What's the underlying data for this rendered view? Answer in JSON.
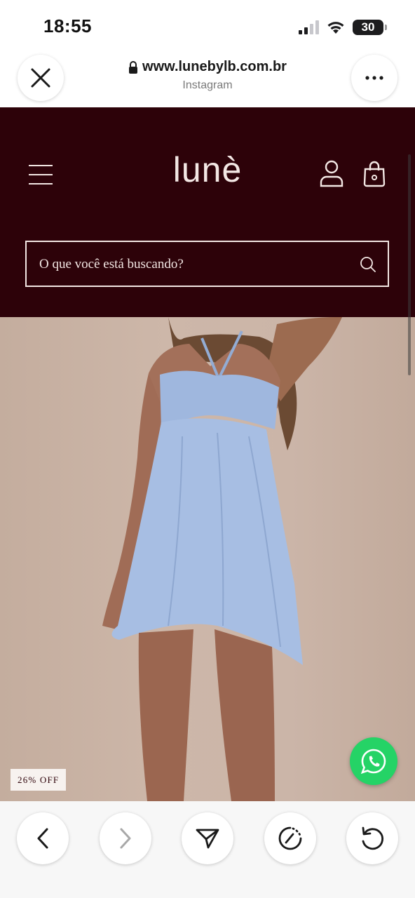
{
  "status_bar": {
    "time": "18:55",
    "battery": "30",
    "battery_level": 0.3
  },
  "browser": {
    "url": "www.lunebylb.com.br",
    "source": "Instagram"
  },
  "site": {
    "logo": "lunè",
    "search_placeholder": "O que você está buscando?",
    "header_color": "#2d0209",
    "accent_color": "#f3e7e4"
  },
  "product": {
    "discount_badge": "26% OFF"
  },
  "icons": {
    "close": "close-icon",
    "more": "more-icon",
    "lock": "lock-icon",
    "menu": "menu-icon",
    "user": "user-icon",
    "bag": "bag-icon",
    "search": "search-icon",
    "whatsapp": "whatsapp-icon",
    "back": "back-icon",
    "forward": "forward-icon",
    "share": "share-icon",
    "speed": "speed-icon",
    "reload": "reload-icon"
  },
  "colors": {
    "whatsapp_green": "#25d366"
  }
}
